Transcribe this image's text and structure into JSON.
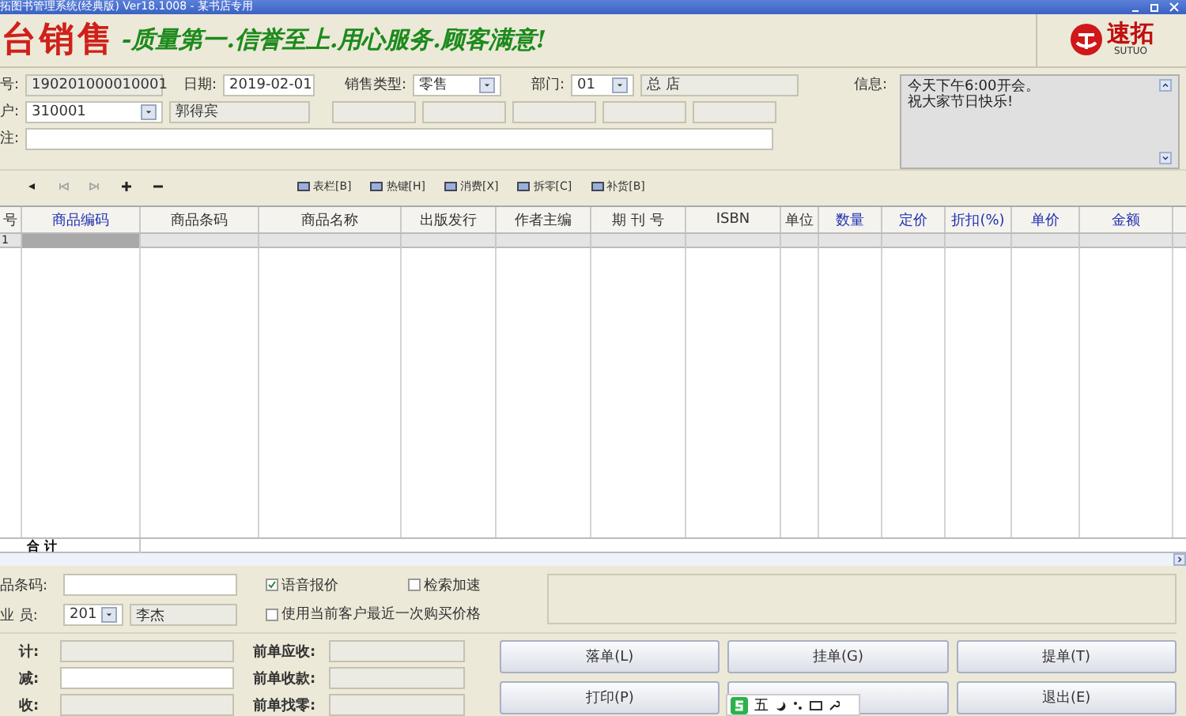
{
  "window": {
    "title": "拓图书管理系统(经典版) Ver18.1008 - 某书店专用"
  },
  "banner": {
    "heading": "台销售",
    "slogan": "-质量第一.信誉至上.用心服务.顾客满意!",
    "logo_name": "速拓",
    "logo_sub": "SUTUO"
  },
  "form": {
    "order_label": "号:",
    "order_no": "190201000010001",
    "date_label": "日期:",
    "date": "2019-02-01",
    "sale_type_label": "销售类型:",
    "sale_type": "零售",
    "dept_label": "部门:",
    "dept_code": "01",
    "dept_name": "总  店",
    "customer_label": "户:",
    "customer_code": "310001",
    "customer_name": "郭得宾",
    "note_label": "注:",
    "info_label": "信息:",
    "info_lines": [
      "今天下午6:00开会。",
      "祝大家节日快乐!"
    ]
  },
  "toolbar": {
    "buttons": [
      "表栏[B]",
      "热键[H]",
      "消费[X]",
      "拆零[C]",
      "补货[B]"
    ]
  },
  "table": {
    "columns": [
      {
        "label": "号",
        "highlight": false
      },
      {
        "label": "商品编码",
        "highlight": true
      },
      {
        "label": "商品条码",
        "highlight": false
      },
      {
        "label": "商品名称",
        "highlight": false
      },
      {
        "label": "出版发行",
        "highlight": false
      },
      {
        "label": "作者主编",
        "highlight": false
      },
      {
        "label": "期 刊 号",
        "highlight": false
      },
      {
        "label": "ISBN",
        "highlight": false
      },
      {
        "label": "单位",
        "highlight": false
      },
      {
        "label": "数量",
        "highlight": true
      },
      {
        "label": "定价",
        "highlight": true
      },
      {
        "label": "折扣(%)",
        "highlight": true
      },
      {
        "label": "单价",
        "highlight": true
      },
      {
        "label": "金额",
        "highlight": true
      }
    ],
    "rows": [
      {
        "number": "1"
      }
    ],
    "total_label": "合  计"
  },
  "entry": {
    "barcode_label": "品条码:",
    "clerk_label": "业 员:",
    "clerk_code": "201",
    "clerk_name": "李杰",
    "options": [
      {
        "label": "语音报价",
        "checked": true
      },
      {
        "label": "检索加速",
        "checked": false
      },
      {
        "label": "使用当前客户最近一次购买价格",
        "checked": false
      }
    ]
  },
  "totals": {
    "left": [
      "计:",
      "减:",
      "收:"
    ],
    "right": [
      "前单应收:",
      "前单收款:",
      "前单找零:"
    ]
  },
  "actions": [
    {
      "label": "落单(L)"
    },
    {
      "label": "挂单(G)"
    },
    {
      "label": "提单(T)"
    },
    {
      "label": "打印(P)"
    },
    {
      "covered": true
    },
    {
      "label": "退出(E)"
    }
  ],
  "ime": {
    "mode": "五"
  }
}
